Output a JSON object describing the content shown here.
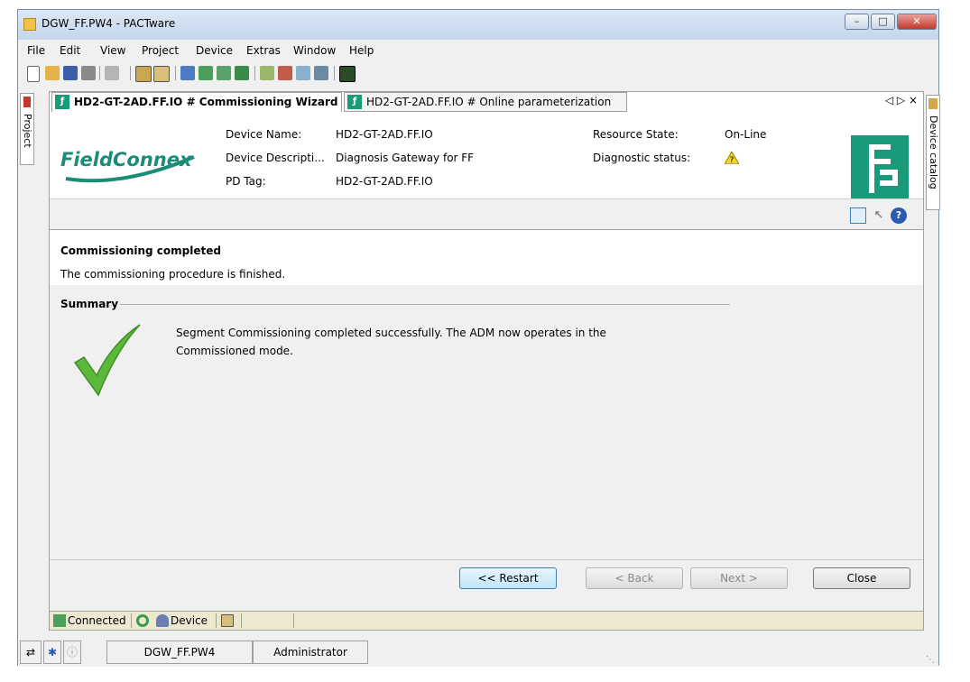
{
  "window": {
    "title": "DGW_FF.PW4 - PACTware"
  },
  "menu": [
    "File",
    "Edit",
    "View",
    "Project",
    "Device",
    "Extras",
    "Window",
    "Help"
  ],
  "side_tabs": {
    "left": "Project",
    "right": "Device catalog"
  },
  "tabs": [
    {
      "label": "HD2-GT-2AD.FF.IO # Commissioning Wizard",
      "active": true
    },
    {
      "label": "HD2-GT-2AD.FF.IO # Online parameterization",
      "active": false
    }
  ],
  "tab_nav": "◁ ▷ ×",
  "header": {
    "logo_text": "FieldConnex",
    "device_name_label": "Device Name:",
    "device_name_value": "HD2-GT-2AD.FF.IO",
    "device_desc_label": "Device Descripti...",
    "device_desc_value": "Diagnosis Gateway for FF",
    "pd_tag_label": "PD Tag:",
    "pd_tag_value": "HD2-GT-2AD.FF.IO",
    "resource_state_label": "Resource State:",
    "resource_state_value": "On-Line",
    "diagnostic_status_label": "Diagnostic status:",
    "diagnostic_status_icon": "warning-icon"
  },
  "status_message": {
    "title": "Commissioning completed",
    "text": "The commissioning procedure is finished."
  },
  "summary": {
    "title": "Summary",
    "text_line1": "Segment Commissioning completed successfully. The ADM now operates in the",
    "text_line2": "Commissioned mode."
  },
  "buttons": {
    "restart": "<< Restart",
    "back": "< Back",
    "next": "Next >",
    "close": "Close"
  },
  "statusbar": {
    "connected": "Connected",
    "device": "Device"
  },
  "bottombar": {
    "project_file": "DGW_FF.PW4",
    "user": "Administrator"
  },
  "colors": {
    "brand_green": "#1a9a7a",
    "logo_teal": "#1a8c78"
  }
}
